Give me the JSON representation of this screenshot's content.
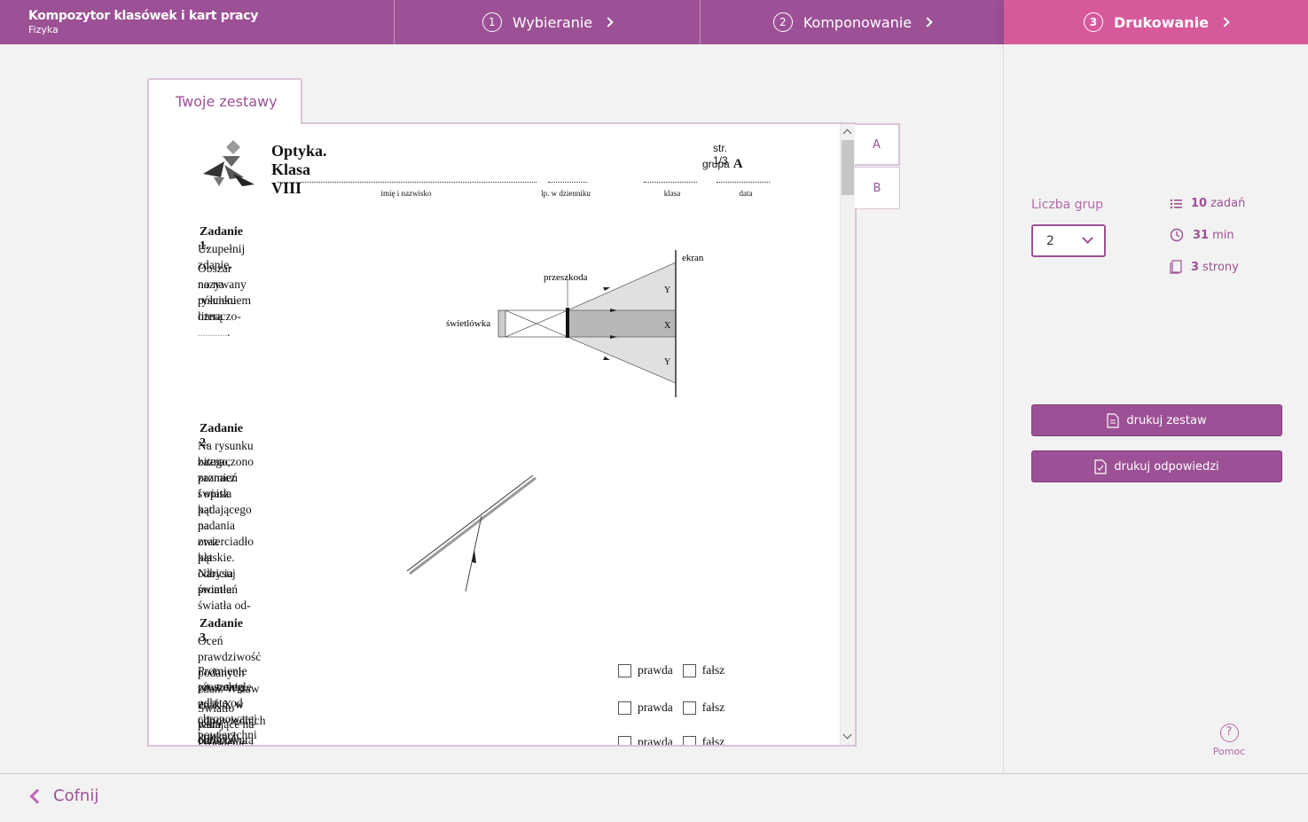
{
  "app": {
    "title": "Kompozytor klasówek i kart pracy",
    "subtitle": "Fizyka"
  },
  "steps": [
    {
      "num": "1",
      "label": "Wybieranie"
    },
    {
      "num": "2",
      "label": "Komponowanie"
    },
    {
      "num": "3",
      "label": "Drukowanie"
    }
  ],
  "tab": {
    "label": "Twoje zestawy"
  },
  "group_tabs": [
    "A",
    "B"
  ],
  "worksheet": {
    "title": "Optyka. Klasa VIII",
    "page": "str. 1/3",
    "group_label": "grupa",
    "group": "A",
    "fields": [
      "imię i nazwisko",
      "lp. w dzienniku",
      "klasa",
      "data"
    ],
    "tasks": [
      {
        "heading": "Zadanie 1.",
        "lines": [
          "Uzupełnij zdanie.",
          "Obszar nazywany półcieniem oznaczo-",
          "no na rysunku literą"
        ],
        "blank": "............",
        "figure_labels": {
          "screen": "ekran",
          "obstacle": "przeszkoda",
          "lamp": "świetlówka",
          "y1": "Y",
          "x": "X",
          "y2": "Y"
        }
      },
      {
        "heading": "Zadanie 2.",
        "lines": [
          "Na rysunku zaznaczono promień światła padającego na zwierciadło płaskie. Narysuj promień światła od-",
          "bitego, zaznacz i opisz kąt padania oraz kąt odbicia światła."
        ]
      },
      {
        "heading": "Zadanie 3.",
        "lines": [
          "Oceń prawdziwość podanych zdań. Wstaw znak X w odpowiednich kratkach."
        ],
        "true_label": "prawda",
        "false_label": "fałsz",
        "statements": [
          [
            "Promienie równoległe odbite od chropowatej powierzchni ulegają roz-",
            "proszeniu."
          ],
          [
            "Światło padające na chropowatą powierzchnię odbija się zgodnie z pra-",
            "wem odbicia."
          ],
          [
            "Promienie równoległe po odbiciu od płaskiego lustra przestają być",
            ""
          ]
        ]
      }
    ]
  },
  "panel": {
    "groups_label": "Liczba grup",
    "groups_value": "2",
    "stats": [
      {
        "icon": "list-icon",
        "value": "10",
        "unit": "zadań"
      },
      {
        "icon": "clock-icon",
        "value": "31",
        "unit": "min"
      },
      {
        "icon": "pages-icon",
        "value": "3",
        "unit": "strony"
      }
    ],
    "print_set": "drukuj zestaw",
    "print_answers": "drukuj odpowiedzi",
    "help": "Pomoc"
  },
  "footer": {
    "back": "Cofnij"
  },
  "colors": {
    "brand": "#9c5095",
    "active_step": "#d6599c",
    "accent_text": "#b06aa8"
  }
}
